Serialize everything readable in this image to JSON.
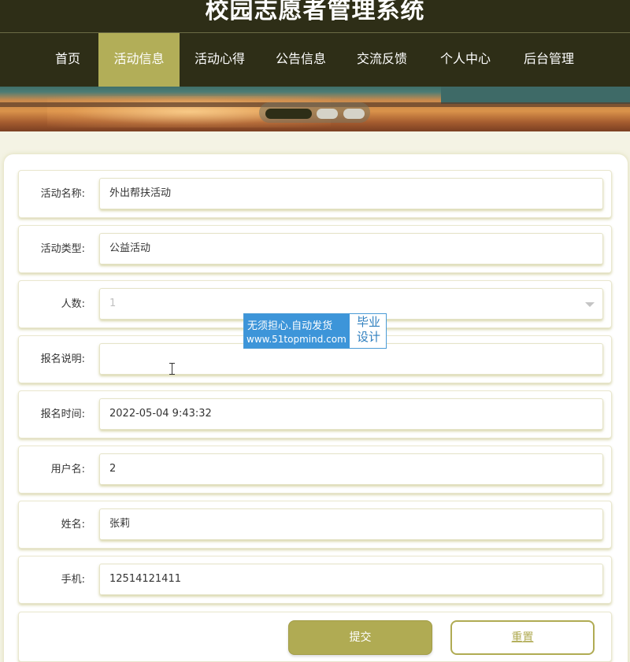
{
  "site": {
    "title": "校园志愿者管理系统"
  },
  "nav": {
    "items": [
      {
        "label": "首页",
        "active": false
      },
      {
        "label": "活动信息",
        "active": true
      },
      {
        "label": "活动心得",
        "active": false
      },
      {
        "label": "公告信息",
        "active": false
      },
      {
        "label": "交流反馈",
        "active": false
      },
      {
        "label": "个人中心",
        "active": false
      },
      {
        "label": "后台管理",
        "active": false
      }
    ]
  },
  "carousel": {
    "slide_count": 3,
    "active_index": 0
  },
  "form": {
    "fields": [
      {
        "label": "活动名称:",
        "value": "外出帮扶活动",
        "type": "text"
      },
      {
        "label": "活动类型:",
        "value": "公益活动",
        "type": "text"
      },
      {
        "label": "人数:",
        "value": "1",
        "type": "select",
        "disabled": true
      },
      {
        "label": "报名说明:",
        "value": "",
        "type": "text"
      },
      {
        "label": "报名时间:",
        "value": "2022-05-04 9:43:32",
        "type": "text"
      },
      {
        "label": "用户名:",
        "value": "2",
        "type": "text"
      },
      {
        "label": "姓名:",
        "value": "张莉",
        "type": "text"
      },
      {
        "label": "手机:",
        "value": "12514121411",
        "type": "text"
      }
    ],
    "submit_label": "提交",
    "reset_label": "重置"
  },
  "watermark": {
    "line1": "无须担心.自动发货",
    "line2": "www.51topmind.com",
    "side": "毕业\n设计"
  },
  "colors": {
    "nav_bg": "#2e2e17",
    "accent": "#b0ab53",
    "page_bg": "#f4f3e4",
    "watermark_blue": "#3d95d9"
  }
}
